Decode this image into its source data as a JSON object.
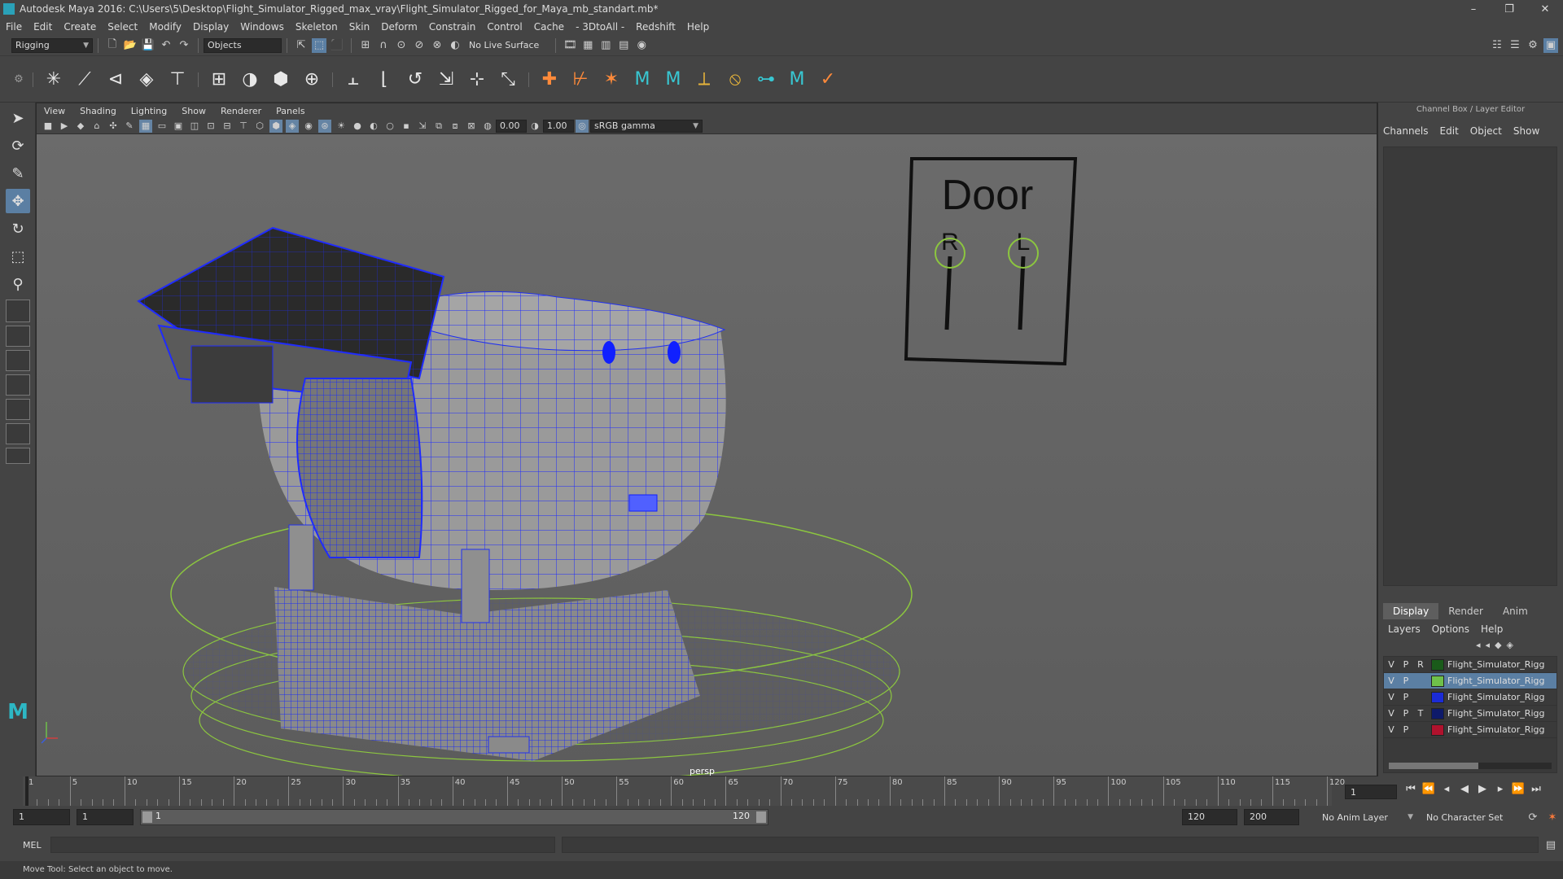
{
  "window": {
    "title": "Autodesk Maya 2016: C:\\Users\\5\\Desktop\\Flight_Simulator_Rigged_max_vray\\Flight_Simulator_Rigged_for_Maya_mb_standart.mb*"
  },
  "menubar": [
    "File",
    "Edit",
    "Create",
    "Select",
    "Modify",
    "Display",
    "Windows",
    "Skeleton",
    "Skin",
    "Deform",
    "Constrain",
    "Control",
    "Cache",
    "- 3DtoAll -",
    "Redshift",
    "Help"
  ],
  "statusline": {
    "menuset": "Rigging",
    "selection_mode": "Objects",
    "live_surface": "No Live Surface"
  },
  "panel": {
    "menu": [
      "View",
      "Shading",
      "Lighting",
      "Show",
      "Renderer",
      "Panels"
    ],
    "exposure": "0.00",
    "gamma": "1.00",
    "color_space": "sRGB gamma",
    "camera": "persp"
  },
  "rig": {
    "title": "Door",
    "left_label": "R",
    "right_label": "L"
  },
  "channelbox": {
    "title": "Channel Box / Layer Editor",
    "menu": [
      "Channels",
      "Edit",
      "Object",
      "Show"
    ],
    "tabs": [
      "Display",
      "Render",
      "Anim"
    ],
    "layer_menu": [
      "Layers",
      "Options",
      "Help"
    ],
    "layers": [
      {
        "v": "V",
        "p": "P",
        "t": "R",
        "color": "#1a5b1a",
        "name": "Flight_Simulator_Rigg"
      },
      {
        "v": "V",
        "p": "P",
        "t": "",
        "color": "#6fc04a",
        "name": "Flight_Simulator_Rigg"
      },
      {
        "v": "V",
        "p": "P",
        "t": "",
        "color": "#1b2bd6",
        "name": "Flight_Simulator_Rigg"
      },
      {
        "v": "V",
        "p": "P",
        "t": "T",
        "color": "#0e1a6a",
        "name": "Flight_Simulator_Rigg"
      },
      {
        "v": "V",
        "p": "P",
        "t": "",
        "color": "#b0122d",
        "name": "Flight_Simulator_Rigg"
      }
    ]
  },
  "timeline": {
    "ticks": [
      "1",
      "5",
      "10",
      "15",
      "20",
      "25",
      "30",
      "35",
      "40",
      "45",
      "50",
      "55",
      "60",
      "65",
      "70",
      "75",
      "80",
      "85",
      "90",
      "95",
      "100",
      "105",
      "110",
      "115",
      "120"
    ],
    "current_frame": "1"
  },
  "range": {
    "start": "1",
    "playback_start": "1",
    "range_start": "1",
    "range_end": "120",
    "playback_end": "120",
    "end": "200",
    "anim_layer": "No Anim Layer",
    "character_set": "No Character Set"
  },
  "cmdline": {
    "label": "MEL"
  },
  "helpline": {
    "text": "Move Tool: Select an object to move."
  }
}
